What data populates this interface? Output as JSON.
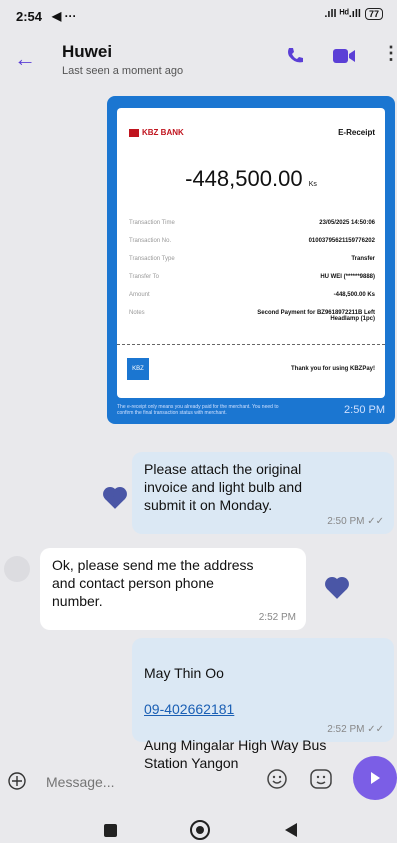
{
  "status_bar": {
    "time": "2:54",
    "nav_glyph": "◀ ···",
    "signal": ".ıll ᴴᵈ.ıll",
    "battery": "77"
  },
  "header": {
    "back_icon": "arrow-left-icon",
    "name": "Huwei",
    "subtitle": "Last seen a moment ago"
  },
  "receipt": {
    "bank": "KBZ BANK",
    "title": "E-Receipt",
    "amount": "-448,500.00",
    "currency": "Ks",
    "rows": [
      {
        "key": "Transaction Time",
        "value": "23/05/2025 14:50:06"
      },
      {
        "key": "Transaction No.",
        "value": "01003795621159776202"
      },
      {
        "key": "Transaction Type",
        "value": "Transfer"
      },
      {
        "key": "Transfer To",
        "value": "HU WEI (******9888)"
      },
      {
        "key": "Amount",
        "value": "-448,500.00 Ks"
      },
      {
        "key": "Notes",
        "value": "Second Payment for BZ9618972211B Left Headlamp (1pc)"
      }
    ],
    "thanks": "Thank you for using KBZPay!",
    "footer_logo": "KBZ Pay",
    "note": "The e-receipt only means you already paid for the merchant. You need to confirm the final transaction status with merchant.",
    "time": "2:50 PM"
  },
  "messages": [
    {
      "id": "out1",
      "text": "Please attach the original\ninvoice and light bulb and\nsubmit it on Monday.",
      "time": "2:50 PM ✓✓"
    },
    {
      "id": "in1",
      "text": "Ok, please send me the address\nand contact person phone\nnumber.",
      "time": "2:52 PM"
    },
    {
      "id": "out2",
      "name": "May Thin Oo",
      "phone": "09-402662181",
      "address": "Aung Mingalar High Way Bus\nStation Yangon",
      "time": "2:52 PM ✓✓"
    }
  ],
  "composer": {
    "placeholder": "Message...",
    "attach_icon": "plus-circle-icon",
    "emoji_icon": "smile-icon",
    "sticker_icon": "sticker-icon",
    "send_icon": "send-icon"
  },
  "colors": {
    "accent": "#5b3fd6",
    "receipt_blue": "#1b76d1",
    "out_bubble": "#dbe8f4",
    "in_bubble": "#ffffff"
  }
}
